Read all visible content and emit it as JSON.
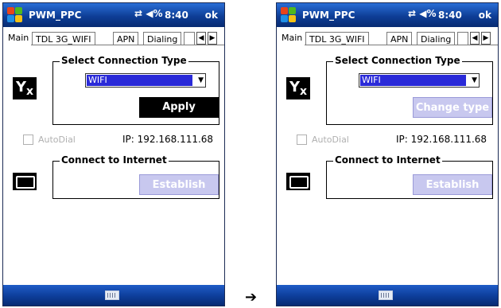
{
  "screens": [
    {
      "titlebar": {
        "title": "PWM_PPC",
        "status_icons": "⇄ ◀%",
        "time": "8:40",
        "ok_label": "ok"
      },
      "tabs": [
        "Main",
        "TDL 3G_WIFI",
        "APN",
        "Dialing"
      ],
      "tab_arrows": {
        "left": "◀",
        "right": "▶"
      },
      "select_connection": {
        "legend": "Select Connection Type",
        "selected": "WIFI",
        "dropdown_arrow": "▼",
        "button_label": "Apply",
        "button_state": "enabled"
      },
      "autodial": {
        "label": "AutoDial",
        "checked": false,
        "enabled": false
      },
      "ip_text": "IP: 192.168.111.68",
      "connect_internet": {
        "legend": "Connect to Internet",
        "button_label": "Establish",
        "button_state": "disabled"
      },
      "icons": {
        "connection": "antenna-x-icon",
        "battery": "battery-icon",
        "keyboard": "keyboard-icon"
      }
    },
    {
      "titlebar": {
        "title": "PWM_PPC",
        "status_icons": "⇄ ◀%",
        "time": "8:40",
        "ok_label": "ok"
      },
      "tabs": [
        "Main",
        "TDL 3G_WIFI",
        "APN",
        "Dialing"
      ],
      "tab_arrows": {
        "left": "◀",
        "right": "▶"
      },
      "select_connection": {
        "legend": "Select Connection Type",
        "selected": "WIFI",
        "dropdown_arrow": "▼",
        "button_label": "Change type",
        "button_state": "disabled"
      },
      "autodial": {
        "label": "AutoDial",
        "checked": false,
        "enabled": false
      },
      "ip_text": "IP: 192.168.111.68",
      "connect_internet": {
        "legend": "Connect to Internet",
        "button_label": "Establish",
        "button_state": "disabled"
      },
      "icons": {
        "connection": "antenna-x-icon",
        "battery": "battery-icon",
        "keyboard": "keyboard-icon"
      }
    }
  ],
  "transition_arrow": "➔",
  "colors": {
    "titlebar": "#0e3e96",
    "selection": "#2a2ad8",
    "disabled_button": "#c8c8ef",
    "primary_button": "#000000"
  }
}
